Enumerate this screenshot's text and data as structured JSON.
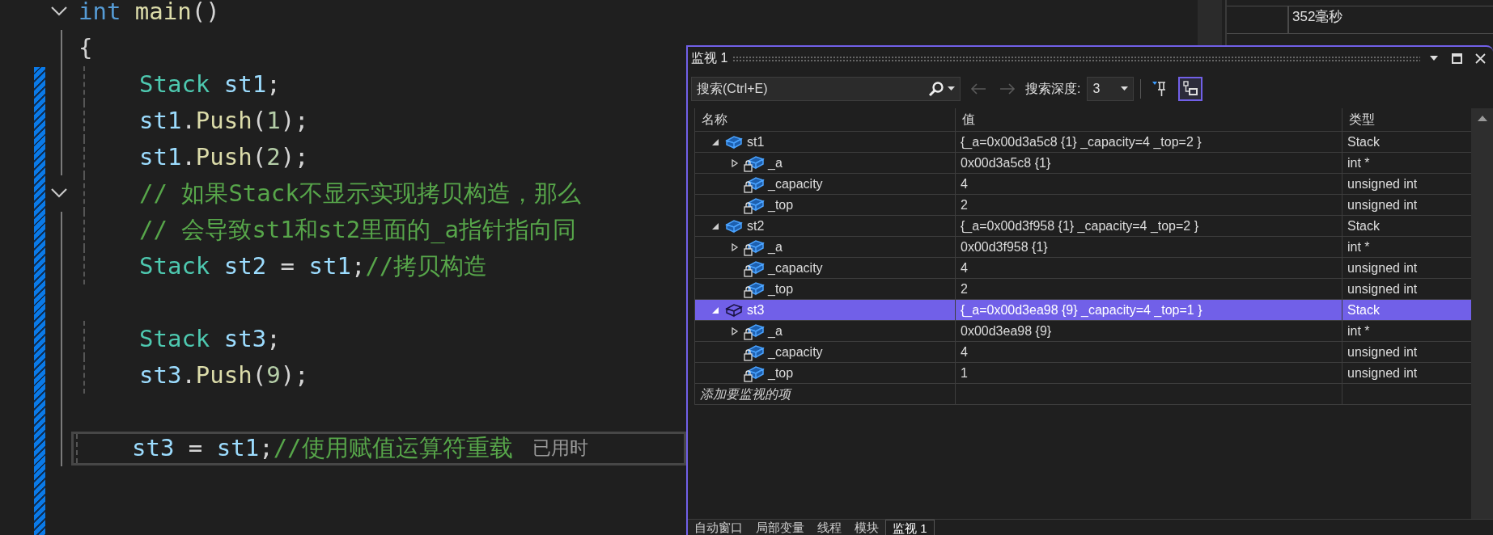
{
  "editor": {
    "lines": [
      {
        "kind": "code",
        "expanded": true,
        "current": false,
        "tokens": [
          {
            "text": "int",
            "kind": "keyword"
          },
          {
            "text": " main",
            "kind": "function"
          },
          {
            "text": "()",
            "kind": "punct"
          }
        ]
      },
      {
        "kind": "code",
        "current": false,
        "tokens": [
          {
            "text": "{",
            "kind": "punct"
          }
        ]
      },
      {
        "kind": "block",
        "current": false,
        "tokens": [
          {
            "text": "Stack",
            "kind": "type"
          },
          {
            "text": " st1",
            "kind": "variable"
          },
          {
            "text": ";",
            "kind": "punct"
          }
        ]
      },
      {
        "kind": "block",
        "current": false,
        "tokens": [
          {
            "text": "st1",
            "kind": "variable"
          },
          {
            "text": ".",
            "kind": "punct"
          },
          {
            "text": "Push",
            "kind": "function"
          },
          {
            "text": "(",
            "kind": "punct"
          },
          {
            "text": "1",
            "kind": "number"
          },
          {
            "text": ");",
            "kind": "punct"
          }
        ]
      },
      {
        "kind": "block",
        "current": false,
        "tokens": [
          {
            "text": "st1",
            "kind": "variable"
          },
          {
            "text": ".",
            "kind": "punct"
          },
          {
            "text": "Push",
            "kind": "function"
          },
          {
            "text": "(",
            "kind": "punct"
          },
          {
            "text": "2",
            "kind": "number"
          },
          {
            "text": ");",
            "kind": "punct"
          }
        ]
      },
      {
        "kind": "block",
        "expanded": true,
        "current": false,
        "tokens": [
          {
            "text": "// 如果Stack不显示实现拷贝构造，那么",
            "kind": "comment"
          }
        ]
      },
      {
        "kind": "block",
        "current": false,
        "tokens": [
          {
            "text": "// 会导致st1和st2里面的_a指针指向同",
            "kind": "comment"
          }
        ]
      },
      {
        "kind": "block",
        "current": false,
        "tokens": [
          {
            "text": "Stack",
            "kind": "type"
          },
          {
            "text": " st2",
            "kind": "variable"
          },
          {
            "text": " = ",
            "kind": "punct"
          },
          {
            "text": "st1",
            "kind": "variable"
          },
          {
            "text": ";",
            "kind": "punct"
          },
          {
            "text": "//拷贝构造",
            "kind": "comment"
          }
        ]
      },
      {
        "kind": "blank"
      },
      {
        "kind": "block",
        "current": false,
        "tokens": [
          {
            "text": "Stack",
            "kind": "type"
          },
          {
            "text": " st3",
            "kind": "variable"
          },
          {
            "text": ";",
            "kind": "punct"
          }
        ]
      },
      {
        "kind": "block",
        "current": false,
        "tokens": [
          {
            "text": "st3",
            "kind": "variable"
          },
          {
            "text": ".",
            "kind": "punct"
          },
          {
            "text": "Push",
            "kind": "function"
          },
          {
            "text": "(",
            "kind": "punct"
          },
          {
            "text": "9",
            "kind": "number"
          },
          {
            "text": ");",
            "kind": "punct"
          }
        ]
      },
      {
        "kind": "blank"
      },
      {
        "kind": "block",
        "current": true,
        "hint": "已用时",
        "tokens": [
          {
            "text": "st3",
            "kind": "variable"
          },
          {
            "text": " = ",
            "kind": "punct"
          },
          {
            "text": "st1",
            "kind": "variable"
          },
          {
            "text": ";",
            "kind": "punct"
          },
          {
            "text": "//使用赋值运算符重载",
            "kind": "comment"
          }
        ]
      }
    ]
  },
  "diagnostics": {
    "timeline_label": "352毫秒"
  },
  "watch_window": {
    "title": "监视 1",
    "search": {
      "placeholder": "搜索(Ctrl+E)"
    },
    "nav": [
      {
        "kind": "back",
        "disabled": true
      },
      {
        "kind": "forward",
        "disabled": true
      }
    ],
    "depth_label": "搜索深度:",
    "depth": "3",
    "toggles": [
      {
        "kind": "pin",
        "selected": false
      },
      {
        "kind": "raw",
        "selected": true
      }
    ],
    "columns": [
      "名称",
      "值",
      "类型"
    ],
    "items": [
      {
        "name": "st1",
        "value": "{_a=0x00d3a5c8 {1} _capacity=4 _top=2 }",
        "type": "Stack",
        "kind": "object",
        "expanded": true,
        "selected": false,
        "children": [
          {
            "name": "_a",
            "value": "0x00d3a5c8 {1}",
            "type": "int *",
            "kind": "member",
            "expanded": false,
            "selected": false
          },
          {
            "name": "_capacity",
            "value": "4",
            "type": "unsigned int",
            "kind": "member",
            "selected": false
          },
          {
            "name": "_top",
            "value": "2",
            "type": "unsigned int",
            "kind": "member",
            "selected": false
          }
        ]
      },
      {
        "name": "st2",
        "value": "{_a=0x00d3f958 {1} _capacity=4 _top=2 }",
        "type": "Stack",
        "kind": "object",
        "expanded": true,
        "selected": false,
        "children": [
          {
            "name": "_a",
            "value": "0x00d3f958 {1}",
            "type": "int *",
            "kind": "member",
            "expanded": false,
            "selected": false
          },
          {
            "name": "_capacity",
            "value": "4",
            "type": "unsigned int",
            "kind": "member",
            "selected": false
          },
          {
            "name": "_top",
            "value": "2",
            "type": "unsigned int",
            "kind": "member",
            "selected": false
          }
        ]
      },
      {
        "name": "st3",
        "value": "{_a=0x00d3ea98 {9} _capacity=4 _top=1 }",
        "type": "Stack",
        "kind": "object",
        "expanded": true,
        "selected": true,
        "children": [
          {
            "name": "_a",
            "value": "0x00d3ea98 {9}",
            "type": "int *",
            "kind": "member",
            "expanded": false,
            "selected": false
          },
          {
            "name": "_capacity",
            "value": "4",
            "type": "unsigned int",
            "kind": "member",
            "selected": false
          },
          {
            "name": "_top",
            "value": "1",
            "type": "unsigned int",
            "kind": "member",
            "selected": false
          }
        ]
      }
    ],
    "add_placeholder": "添加要监视的项",
    "tabs": [
      {
        "label": "自动窗口",
        "selected": false
      },
      {
        "label": "局部变量",
        "selected": false
      },
      {
        "label": "线程",
        "selected": false
      },
      {
        "label": "模块",
        "selected": false
      },
      {
        "label": "监视 1",
        "selected": true
      }
    ]
  }
}
